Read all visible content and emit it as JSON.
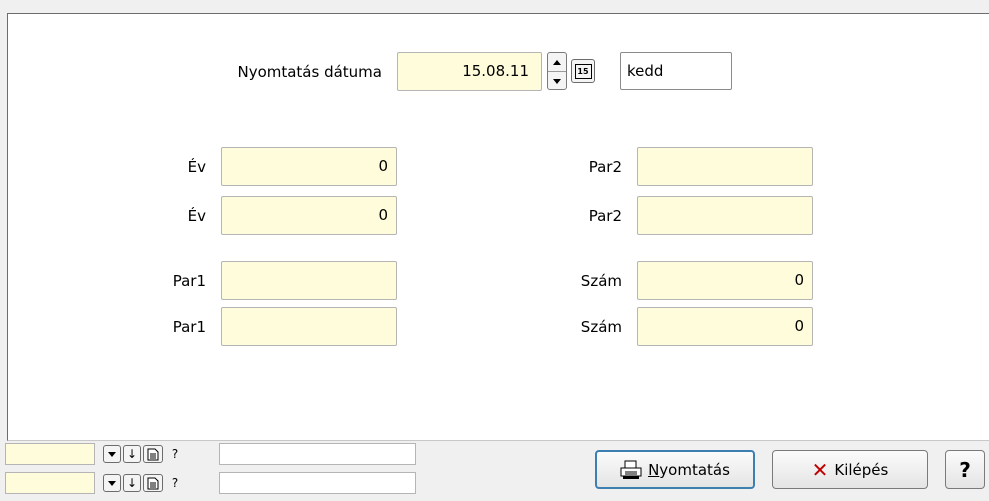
{
  "print_date": {
    "label": "Nyomtatás dátuma",
    "value": "15.08.11",
    "weekday": "kedd",
    "calendar_icon_text": "15"
  },
  "left_fields": [
    {
      "label": "Év",
      "value": "0"
    },
    {
      "label": "Év",
      "value": "0"
    },
    {
      "label": "Par1",
      "value": ""
    },
    {
      "label": "Par1",
      "value": ""
    }
  ],
  "right_fields": [
    {
      "label": "Par2",
      "value": ""
    },
    {
      "label": "Par2",
      "value": ""
    },
    {
      "label": "Szám",
      "value": "0"
    },
    {
      "label": "Szám",
      "value": "0"
    }
  ],
  "toolbar": {
    "print_label_first": "N",
    "print_label_rest": "yomtatás",
    "exit_label": "Kilépés",
    "help_label": "?"
  },
  "strip": {
    "help_glyph": "?"
  }
}
